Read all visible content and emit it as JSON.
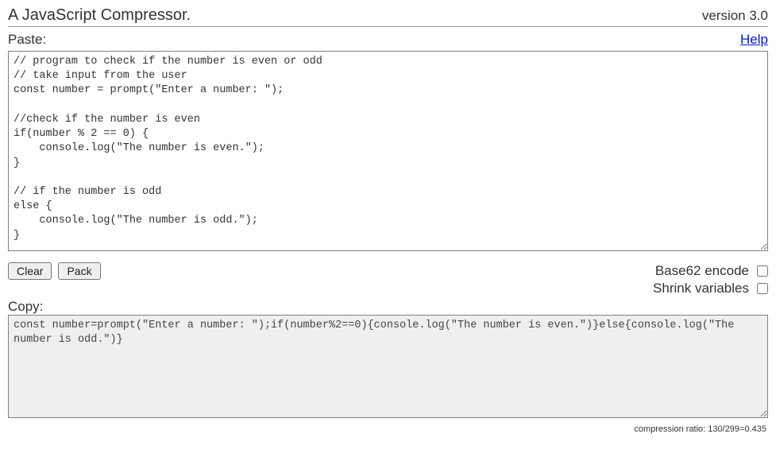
{
  "header": {
    "title": "A JavaScript Compressor.",
    "version": "version 3.0"
  },
  "paste": {
    "label": "Paste:",
    "help_link": "Help"
  },
  "input_code": "// program to check if the number is even or odd\n// take input from the user\nconst number = prompt(\"Enter a number: \");\n\n//check if the number is even\nif(number % 2 == 0) {\n    console.log(\"The number is even.\");\n}\n\n// if the number is odd\nelse {\n    console.log(\"The number is odd.\");\n}",
  "buttons": {
    "clear": "Clear",
    "pack": "Pack"
  },
  "options": {
    "base62": {
      "label": "Base62 encode",
      "checked": false
    },
    "shrink": {
      "label": "Shrink variables",
      "checked": false
    }
  },
  "copy": {
    "label": "Copy:"
  },
  "output_code": "const number=prompt(\"Enter a number: \");if(number%2==0){console.log(\"The number is even.\")}else{console.log(\"The number is odd.\")}",
  "status": "compression ratio: 130/299=0.435"
}
